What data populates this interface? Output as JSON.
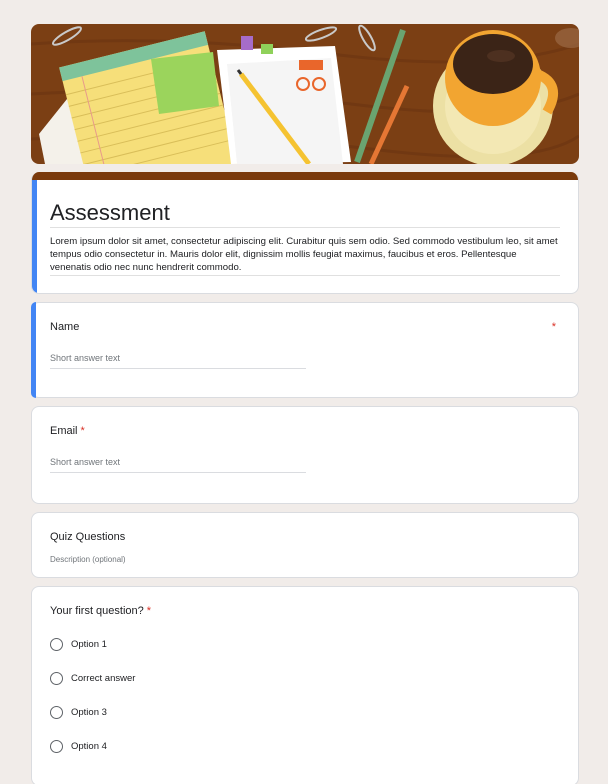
{
  "form": {
    "title": "Assessment",
    "description": "Lorem ipsum dolor sit amet, consectetur adipiscing elit. Curabitur quis sem odio. Sed commodo vestibulum leo, sit amet tempus odio consectetur in. Mauris dolor elit, dignissim mollis feugiat maximus, faucibus et eros. Pellentesque venenatis odio nec nunc hendrerit commodo."
  },
  "questions": {
    "name": {
      "label": "Name",
      "required_mark": "*",
      "placeholder": "Short answer text"
    },
    "email": {
      "label": "Email",
      "required_mark": "*",
      "placeholder": "Short answer text"
    },
    "section": {
      "title": "Quiz Questions",
      "description": "Description (optional)"
    },
    "q1": {
      "label": "Your first question?",
      "required_mark": "*",
      "options": [
        "Option 1",
        "Correct answer",
        "Option 3",
        "Option 4"
      ]
    }
  },
  "colors": {
    "accent": "#4285f4",
    "header_bar": "#7a3a0c",
    "required": "#d93025",
    "background": "#f1ece9"
  },
  "icons": {
    "banner": "desk-with-notepad-coffee-illustration",
    "radio": "radio-button-icon"
  }
}
